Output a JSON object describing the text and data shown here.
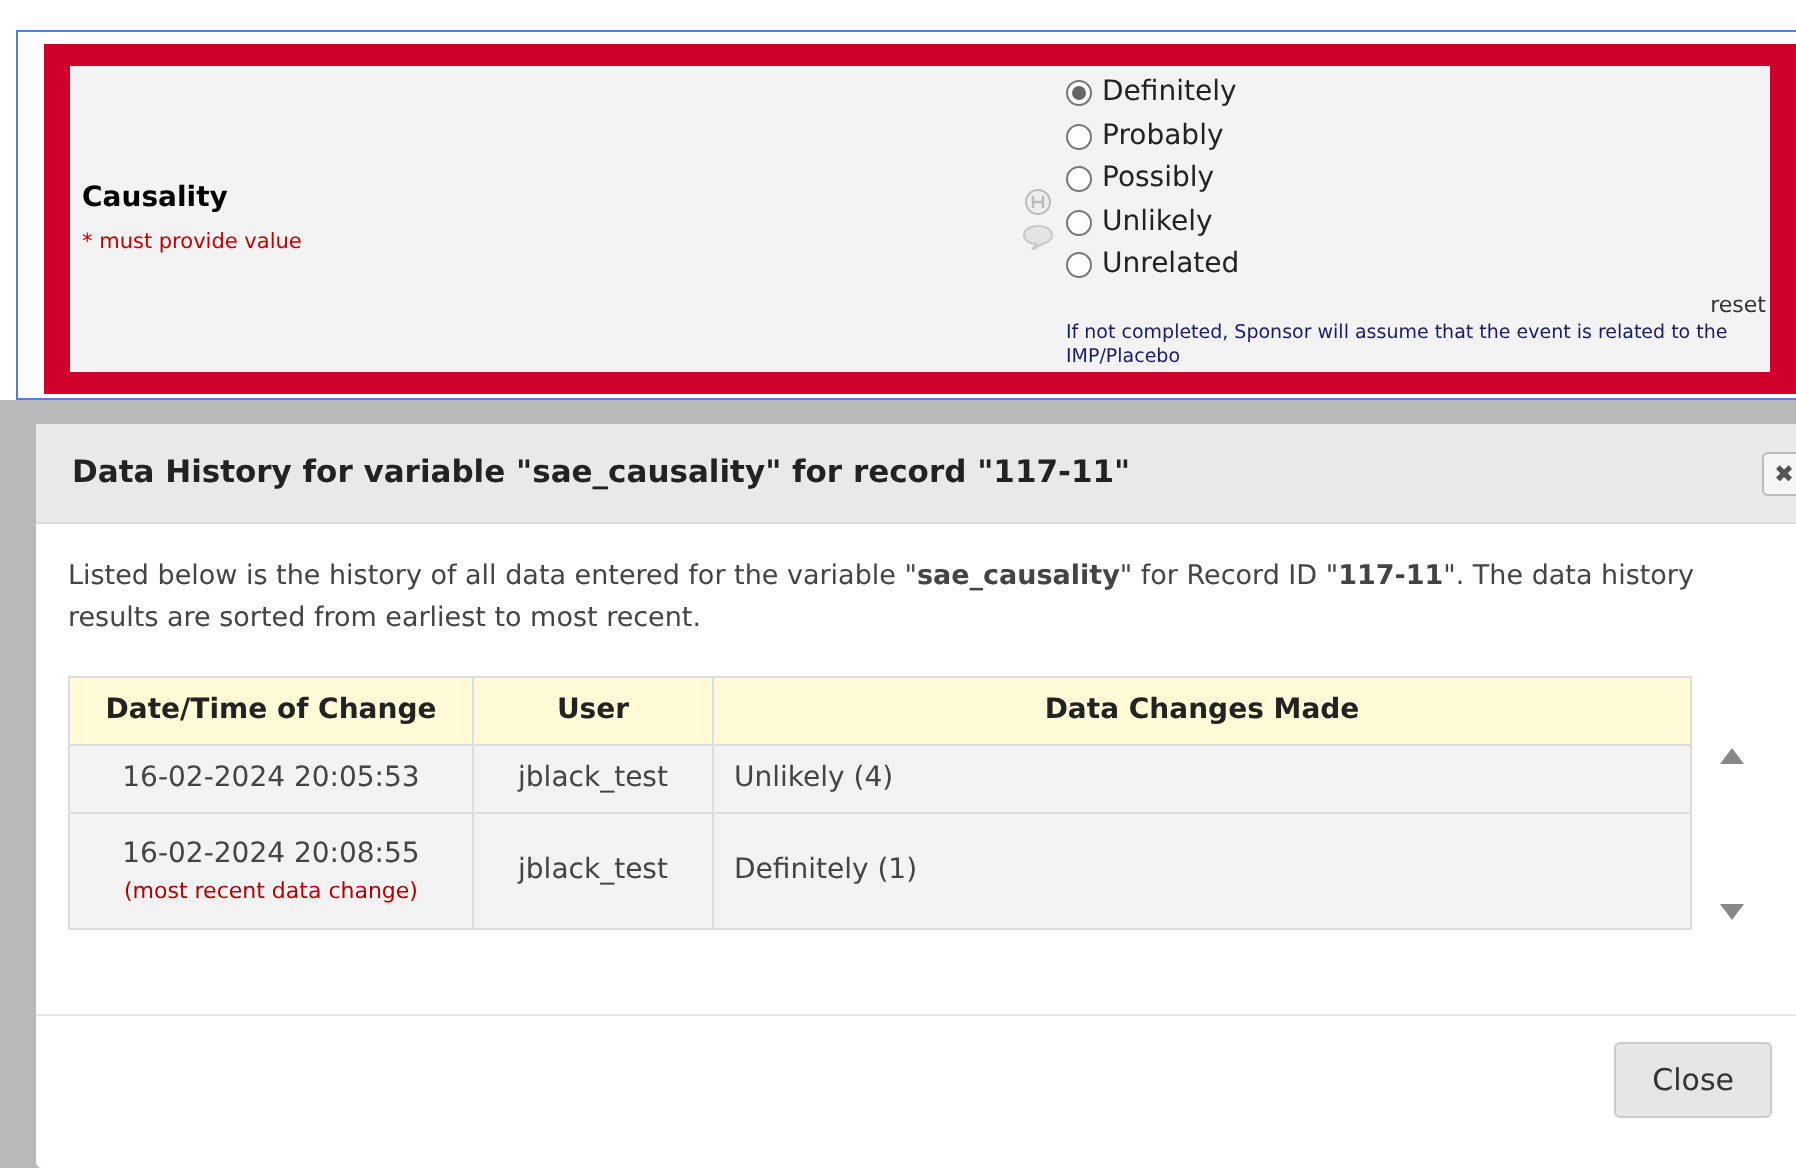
{
  "field": {
    "label": "Causality",
    "required_note": "* must provide value",
    "options": [
      {
        "label": "Definitely",
        "selected": true
      },
      {
        "label": "Probably",
        "selected": false
      },
      {
        "label": "Possibly",
        "selected": false
      },
      {
        "label": "Unlikely",
        "selected": false
      },
      {
        "label": "Unrelated",
        "selected": false
      }
    ],
    "reset": "reset",
    "note": "If not completed, Sponsor will assume that the event is related to the IMP/Placebo"
  },
  "dialog": {
    "title": "Data History for variable \"sae_causality\" for record \"117-11\"",
    "close_icon": "✖",
    "intro": "Listed below is the history of all data entered for the variable \"**sae_causality**\" for Record ID \"**117-11**\". The data history results are sorted from earliest to most recent.",
    "table": {
      "columns": [
        "Date/Time of Change",
        "User",
        "Data Changes Made"
      ],
      "rows": [
        {
          "datetime": "16-02-2024 20:05:53",
          "note": null,
          "user": "jblack_test",
          "change": "Unlikely (4)"
        },
        {
          "datetime": "16-02-2024 20:08:55",
          "note": "(most recent data change)",
          "user": "jblack_test",
          "change": "Definitely (1)"
        }
      ]
    },
    "buttons": [
      "Close"
    ]
  }
}
